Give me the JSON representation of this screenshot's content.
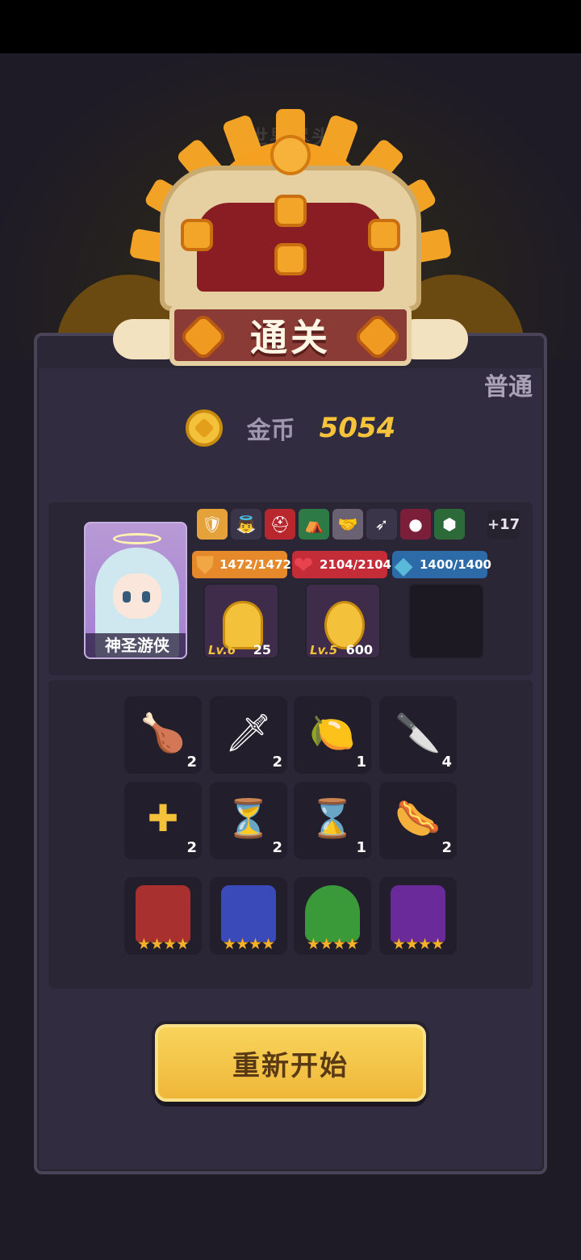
{
  "header": {
    "world_title": "世界尽头",
    "banner": "通关"
  },
  "difficulty": "普通",
  "coins": {
    "label": "金币",
    "value": "5054"
  },
  "hero": {
    "name": "神圣游侠",
    "buffs": [
      "shield-crown-icon",
      "angel-icon",
      "helmet-icon",
      "tent-icon",
      "handshake-icon",
      "arrow-icon",
      "orb-icon",
      "turtle-shell-icon"
    ],
    "buffs_more": "+17",
    "stats": {
      "shield": "1472/1472",
      "hp": "2104/2104",
      "mana": "1400/1400"
    },
    "skills": [
      {
        "level": "Lv.6",
        "count": "25"
      },
      {
        "level": "Lv.5",
        "count": "600"
      }
    ]
  },
  "items": [
    {
      "icon": "roast-meat-icon",
      "qty": "2"
    },
    {
      "icon": "dagger-icon",
      "qty": "2"
    },
    {
      "icon": "lemon-icon",
      "qty": "1"
    },
    {
      "icon": "knife-icon",
      "qty": "4"
    },
    {
      "icon": "gold-cross-icon",
      "qty": "2"
    },
    {
      "icon": "hourglass-ornate-icon",
      "qty": "2"
    },
    {
      "icon": "hourglass-icon",
      "qty": "1"
    },
    {
      "icon": "hotdog-icon",
      "qty": "2"
    }
  ],
  "companions": [
    {
      "icon": "red-wizard-icon",
      "stars": "★★★★"
    },
    {
      "icon": "blue-knight-icon",
      "stars": "★★★★"
    },
    {
      "icon": "chameleon-icon",
      "stars": "★★★★"
    },
    {
      "icon": "purple-priest-icon",
      "stars": "★★★★"
    }
  ],
  "actions": {
    "restart": "重新开始"
  },
  "colors": {
    "gold": "#f6c33a",
    "panel": "#312c40",
    "button": "#f8d45a"
  }
}
